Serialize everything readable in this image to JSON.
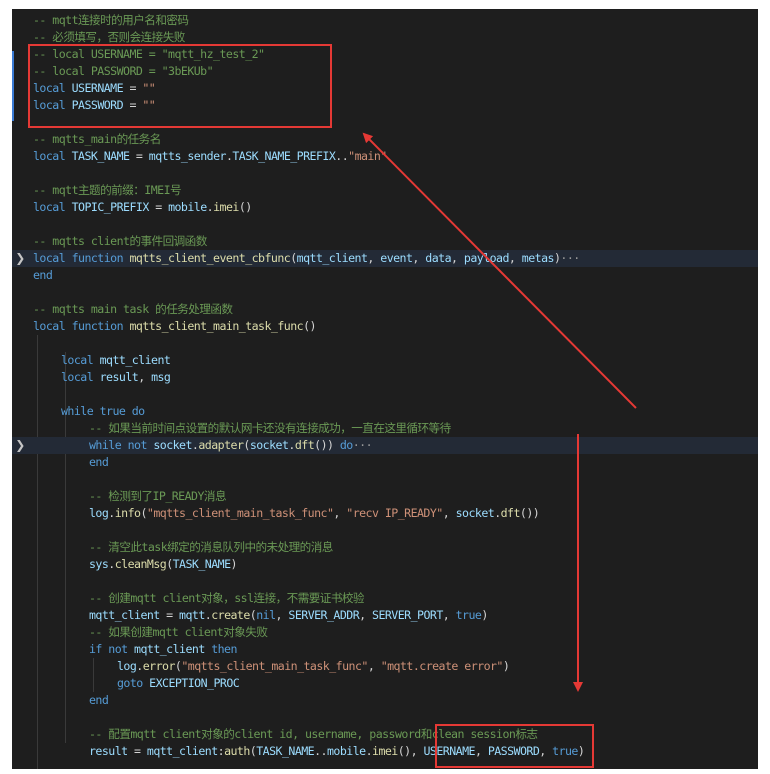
{
  "editor": {
    "lines": [
      {
        "indent": 0,
        "fold": false,
        "highlight": false,
        "tokens": [
          {
            "t": "-- mqtt连接时的用户名和密码",
            "c": "c"
          }
        ]
      },
      {
        "indent": 0,
        "fold": false,
        "highlight": false,
        "tokens": [
          {
            "t": "-- 必须填写，否则会连接失败",
            "c": "c"
          }
        ]
      },
      {
        "indent": 0,
        "fold": false,
        "highlight": false,
        "tokens": [
          {
            "t": "-- local USERNAME = \"mqtt_hz_test_2\"",
            "c": "c"
          }
        ]
      },
      {
        "indent": 0,
        "fold": false,
        "highlight": false,
        "tokens": [
          {
            "t": "-- local PASSWORD = \"3bEKUb\"",
            "c": "c"
          }
        ]
      },
      {
        "indent": 0,
        "fold": false,
        "highlight": false,
        "tokens": [
          {
            "t": "local ",
            "c": "k"
          },
          {
            "t": "USERNAME",
            "c": "v"
          },
          {
            "t": " = ",
            "c": "p"
          },
          {
            "t": "\"\"",
            "c": "s"
          }
        ]
      },
      {
        "indent": 0,
        "fold": false,
        "highlight": false,
        "tokens": [
          {
            "t": "local ",
            "c": "k"
          },
          {
            "t": "PASSWORD",
            "c": "v"
          },
          {
            "t": " = ",
            "c": "p"
          },
          {
            "t": "\"\"",
            "c": "s"
          }
        ]
      },
      {
        "indent": 0,
        "fold": false,
        "highlight": false,
        "tokens": []
      },
      {
        "indent": 0,
        "fold": false,
        "highlight": false,
        "tokens": [
          {
            "t": "-- mqtts_main的任务名",
            "c": "c"
          }
        ]
      },
      {
        "indent": 0,
        "fold": false,
        "highlight": false,
        "tokens": [
          {
            "t": "local ",
            "c": "k"
          },
          {
            "t": "TASK_NAME",
            "c": "v"
          },
          {
            "t": " = ",
            "c": "p"
          },
          {
            "t": "mqtts_sender",
            "c": "v"
          },
          {
            "t": ".",
            "c": "p"
          },
          {
            "t": "TASK_NAME_PREFIX",
            "c": "v"
          },
          {
            "t": "..",
            "c": "p"
          },
          {
            "t": "\"main\"",
            "c": "s"
          }
        ]
      },
      {
        "indent": 0,
        "fold": false,
        "highlight": false,
        "tokens": []
      },
      {
        "indent": 0,
        "fold": false,
        "highlight": false,
        "tokens": [
          {
            "t": "-- mqtt主题的前缀：IMEI号",
            "c": "c"
          }
        ]
      },
      {
        "indent": 0,
        "fold": false,
        "highlight": false,
        "tokens": [
          {
            "t": "local ",
            "c": "k"
          },
          {
            "t": "TOPIC_PREFIX",
            "c": "v"
          },
          {
            "t": " = ",
            "c": "p"
          },
          {
            "t": "mobile",
            "c": "v"
          },
          {
            "t": ".",
            "c": "p"
          },
          {
            "t": "imei",
            "c": "f"
          },
          {
            "t": "()",
            "c": "p"
          }
        ]
      },
      {
        "indent": 0,
        "fold": false,
        "highlight": false,
        "tokens": []
      },
      {
        "indent": 0,
        "fold": false,
        "highlight": false,
        "tokens": [
          {
            "t": "-- mqtts client的事件回调函数",
            "c": "c"
          }
        ]
      },
      {
        "indent": 0,
        "fold": true,
        "highlight": true,
        "tokens": [
          {
            "t": "local function ",
            "c": "k"
          },
          {
            "t": "mqtts_client_event_cbfunc",
            "c": "f"
          },
          {
            "t": "(",
            "c": "p"
          },
          {
            "t": "mqtt_client",
            "c": "v"
          },
          {
            "t": ", ",
            "c": "p"
          },
          {
            "t": "event",
            "c": "v"
          },
          {
            "t": ", ",
            "c": "p"
          },
          {
            "t": "data",
            "c": "v"
          },
          {
            "t": ", ",
            "c": "p"
          },
          {
            "t": "payload",
            "c": "v"
          },
          {
            "t": ", ",
            "c": "p"
          },
          {
            "t": "metas",
            "c": "v"
          },
          {
            "t": ")",
            "c": "p"
          },
          {
            "t": "···",
            "c": "dots"
          }
        ]
      },
      {
        "indent": 0,
        "fold": false,
        "highlight": false,
        "tokens": [
          {
            "t": "end",
            "c": "k"
          }
        ]
      },
      {
        "indent": 0,
        "fold": false,
        "highlight": false,
        "tokens": []
      },
      {
        "indent": 0,
        "fold": false,
        "highlight": false,
        "tokens": [
          {
            "t": "-- mqtts main task 的任务处理函数",
            "c": "c"
          }
        ]
      },
      {
        "indent": 0,
        "fold": false,
        "highlight": false,
        "tokens": [
          {
            "t": "local function ",
            "c": "k"
          },
          {
            "t": "mqtts_client_main_task_func",
            "c": "f"
          },
          {
            "t": "()",
            "c": "p"
          }
        ]
      },
      {
        "indent": 0,
        "fold": false,
        "highlight": false,
        "tokens": []
      },
      {
        "indent": 1,
        "fold": false,
        "highlight": false,
        "tokens": [
          {
            "t": "local ",
            "c": "k"
          },
          {
            "t": "mqtt_client",
            "c": "v"
          }
        ]
      },
      {
        "indent": 1,
        "fold": false,
        "highlight": false,
        "tokens": [
          {
            "t": "local ",
            "c": "k"
          },
          {
            "t": "result",
            "c": "v"
          },
          {
            "t": ", ",
            "c": "p"
          },
          {
            "t": "msg",
            "c": "v"
          }
        ]
      },
      {
        "indent": 0,
        "fold": false,
        "highlight": false,
        "tokens": []
      },
      {
        "indent": 1,
        "fold": false,
        "highlight": false,
        "tokens": [
          {
            "t": "while ",
            "c": "k"
          },
          {
            "t": "true ",
            "c": "k"
          },
          {
            "t": "do",
            "c": "k"
          }
        ]
      },
      {
        "indent": 2,
        "fold": false,
        "highlight": false,
        "tokens": [
          {
            "t": "-- 如果当前时间点设置的默认网卡还没有连接成功，一直在这里循环等待",
            "c": "c"
          }
        ]
      },
      {
        "indent": 2,
        "fold": true,
        "highlight": true,
        "tokens": [
          {
            "t": "while ",
            "c": "k"
          },
          {
            "t": "not ",
            "c": "k"
          },
          {
            "t": "socket",
            "c": "v"
          },
          {
            "t": ".",
            "c": "p"
          },
          {
            "t": "adapter",
            "c": "f"
          },
          {
            "t": "(",
            "c": "p"
          },
          {
            "t": "socket",
            "c": "v"
          },
          {
            "t": ".",
            "c": "p"
          },
          {
            "t": "dft",
            "c": "f"
          },
          {
            "t": "()) ",
            "c": "p"
          },
          {
            "t": "do",
            "c": "k"
          },
          {
            "t": "···",
            "c": "dots"
          }
        ]
      },
      {
        "indent": 2,
        "fold": false,
        "highlight": false,
        "tokens": [
          {
            "t": "end",
            "c": "k"
          }
        ]
      },
      {
        "indent": 0,
        "fold": false,
        "highlight": false,
        "tokens": []
      },
      {
        "indent": 2,
        "fold": false,
        "highlight": false,
        "tokens": [
          {
            "t": "-- 检测到了IP_READY消息",
            "c": "c"
          }
        ]
      },
      {
        "indent": 2,
        "fold": false,
        "highlight": false,
        "tokens": [
          {
            "t": "log",
            "c": "v"
          },
          {
            "t": ".",
            "c": "p"
          },
          {
            "t": "info",
            "c": "f"
          },
          {
            "t": "(",
            "c": "p"
          },
          {
            "t": "\"mqtts_client_main_task_func\"",
            "c": "s"
          },
          {
            "t": ", ",
            "c": "p"
          },
          {
            "t": "\"recv IP_READY\"",
            "c": "s"
          },
          {
            "t": ", ",
            "c": "p"
          },
          {
            "t": "socket",
            "c": "v"
          },
          {
            "t": ".",
            "c": "p"
          },
          {
            "t": "dft",
            "c": "f"
          },
          {
            "t": "())",
            "c": "p"
          }
        ]
      },
      {
        "indent": 0,
        "fold": false,
        "highlight": false,
        "tokens": []
      },
      {
        "indent": 2,
        "fold": false,
        "highlight": false,
        "tokens": [
          {
            "t": "-- 清空此task绑定的消息队列中的未处理的消息",
            "c": "c"
          }
        ]
      },
      {
        "indent": 2,
        "fold": false,
        "highlight": false,
        "tokens": [
          {
            "t": "sys",
            "c": "v"
          },
          {
            "t": ".",
            "c": "p"
          },
          {
            "t": "cleanMsg",
            "c": "f"
          },
          {
            "t": "(",
            "c": "p"
          },
          {
            "t": "TASK_NAME",
            "c": "v"
          },
          {
            "t": ")",
            "c": "p"
          }
        ]
      },
      {
        "indent": 0,
        "fold": false,
        "highlight": false,
        "tokens": []
      },
      {
        "indent": 2,
        "fold": false,
        "highlight": false,
        "tokens": [
          {
            "t": "-- 创建mqtt client对象，ssl连接，不需要证书校验",
            "c": "c"
          }
        ]
      },
      {
        "indent": 2,
        "fold": false,
        "highlight": false,
        "tokens": [
          {
            "t": "mqtt_client",
            "c": "v"
          },
          {
            "t": " = ",
            "c": "p"
          },
          {
            "t": "mqtt",
            "c": "v"
          },
          {
            "t": ".",
            "c": "p"
          },
          {
            "t": "create",
            "c": "f"
          },
          {
            "t": "(",
            "c": "p"
          },
          {
            "t": "nil",
            "c": "k"
          },
          {
            "t": ", ",
            "c": "p"
          },
          {
            "t": "SERVER_ADDR",
            "c": "v"
          },
          {
            "t": ", ",
            "c": "p"
          },
          {
            "t": "SERVER_PORT",
            "c": "v"
          },
          {
            "t": ", ",
            "c": "p"
          },
          {
            "t": "true",
            "c": "k"
          },
          {
            "t": ")",
            "c": "p"
          }
        ]
      },
      {
        "indent": 2,
        "fold": false,
        "highlight": false,
        "tokens": [
          {
            "t": "-- 如果创建mqtt client对象失败",
            "c": "c"
          }
        ]
      },
      {
        "indent": 2,
        "fold": false,
        "highlight": false,
        "tokens": [
          {
            "t": "if ",
            "c": "k"
          },
          {
            "t": "not ",
            "c": "k"
          },
          {
            "t": "mqtt_client",
            "c": "v"
          },
          {
            "t": " then",
            "c": "k"
          }
        ]
      },
      {
        "indent": 3,
        "fold": false,
        "highlight": false,
        "tokens": [
          {
            "t": "log",
            "c": "v"
          },
          {
            "t": ".",
            "c": "p"
          },
          {
            "t": "error",
            "c": "f"
          },
          {
            "t": "(",
            "c": "p"
          },
          {
            "t": "\"mqtts_client_main_task_func\"",
            "c": "s"
          },
          {
            "t": ", ",
            "c": "p"
          },
          {
            "t": "\"mqtt.create error\"",
            "c": "s"
          },
          {
            "t": ")",
            "c": "p"
          }
        ]
      },
      {
        "indent": 3,
        "fold": false,
        "highlight": false,
        "tokens": [
          {
            "t": "goto ",
            "c": "k"
          },
          {
            "t": "EXCEPTION_PROC",
            "c": "v"
          }
        ]
      },
      {
        "indent": 2,
        "fold": false,
        "highlight": false,
        "tokens": [
          {
            "t": "end",
            "c": "k"
          }
        ]
      },
      {
        "indent": 0,
        "fold": false,
        "highlight": false,
        "tokens": []
      },
      {
        "indent": 2,
        "fold": false,
        "highlight": false,
        "tokens": [
          {
            "t": "-- 配置mqtt client对象的client id, username, password和clean session标志",
            "c": "c"
          }
        ]
      },
      {
        "indent": 2,
        "fold": false,
        "highlight": false,
        "tokens": [
          {
            "t": "result",
            "c": "v"
          },
          {
            "t": " = ",
            "c": "p"
          },
          {
            "t": "mqtt_client",
            "c": "v"
          },
          {
            "t": ":",
            "c": "p"
          },
          {
            "t": "auth",
            "c": "f"
          },
          {
            "t": "(",
            "c": "p"
          },
          {
            "t": "TASK_NAME",
            "c": "v"
          },
          {
            "t": "..",
            "c": "p"
          },
          {
            "t": "mobile",
            "c": "v"
          },
          {
            "t": ".",
            "c": "p"
          },
          {
            "t": "imei",
            "c": "f"
          },
          {
            "t": "(), ",
            "c": "p"
          },
          {
            "t": "USERNAME",
            "c": "v"
          },
          {
            "t": ", ",
            "c": "p"
          },
          {
            "t": "PASSWORD",
            "c": "v"
          },
          {
            "t": ", ",
            "c": "p"
          },
          {
            "t": "true",
            "c": "k"
          },
          {
            "t": ")",
            "c": "p"
          }
        ]
      }
    ]
  },
  "colors": {
    "editor_bg": "#1e1e1e",
    "comment": "#6a9955",
    "keyword": "#569cd6",
    "variable": "#9cdcfe",
    "function": "#dcdcaa",
    "string": "#ce9178",
    "annotation": "#e53935"
  },
  "icons": {
    "fold": "chevron-right-icon",
    "annotation_arrow": "red-arrow-icon"
  }
}
